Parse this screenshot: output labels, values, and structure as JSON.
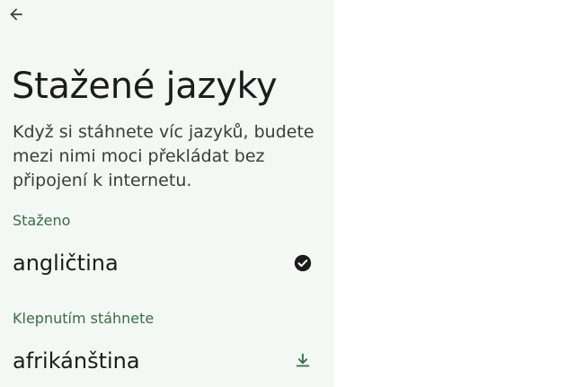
{
  "header": {
    "back_icon": "arrow-back-icon",
    "title": "Stažené jazyky"
  },
  "description": "Když si stáhnete víc jazyků, budete mezi nimi moci překládat bez připojení k internetu.",
  "sections": {
    "downloaded": {
      "header": "Staženo",
      "items": [
        {
          "label": "angličtina",
          "status_icon": "check-circle-icon"
        }
      ]
    },
    "tap_to_download": {
      "header": "Klepnutím stáhnete",
      "items": [
        {
          "label": "afrikánština",
          "status_icon": "download-icon"
        }
      ]
    }
  },
  "colors": {
    "panel_background": "#f4f8f4",
    "section_header": "#3c6b47",
    "download_icon": "#3c6b47",
    "check_icon": "#1b1c1b",
    "text_primary": "#1b1c1b"
  }
}
